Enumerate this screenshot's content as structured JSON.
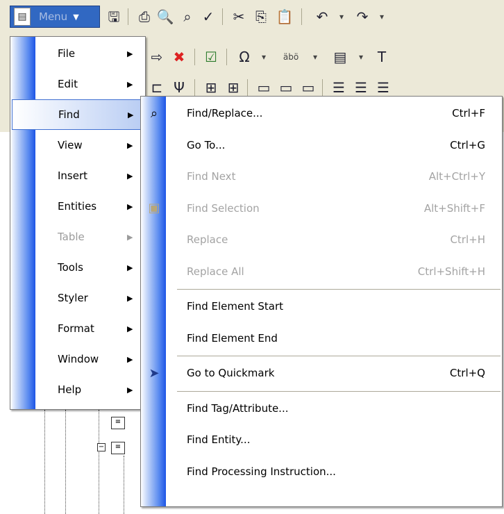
{
  "toolbar": {
    "menu_button_label": "Menu",
    "row1_icons": [
      "save-icon",
      "print-icon",
      "print-preview-icon",
      "find-binoculars-icon",
      "spellcheck-icon",
      "cut-icon",
      "copy-icon",
      "paste-icon",
      "undo-icon",
      "redo-icon"
    ],
    "row2_icons": [
      "insert-element-icon",
      "delete-element-icon",
      "validate-icon",
      "symbol-omega-icon",
      "special-chars-icon",
      "document-icon",
      "text-tag-icon"
    ],
    "row3_icons": [
      "split-icon",
      "join-icon",
      "table-icon",
      "table2-icon",
      "align-left-icon",
      "align-center-icon",
      "align-bottom-icon",
      "justify-icon",
      "justify2-icon",
      "justify3-icon"
    ],
    "special_chars_text": "äbö"
  },
  "main_menu": {
    "items": [
      {
        "label": "File",
        "state": "normal"
      },
      {
        "label": "Edit",
        "state": "normal"
      },
      {
        "label": "Find",
        "state": "selected"
      },
      {
        "label": "View",
        "state": "normal"
      },
      {
        "label": "Insert",
        "state": "normal"
      },
      {
        "label": "Entities",
        "state": "normal"
      },
      {
        "label": "Table",
        "state": "disabled"
      },
      {
        "label": "Tools",
        "state": "normal"
      },
      {
        "label": "Styler",
        "state": "normal"
      },
      {
        "label": "Format",
        "state": "normal"
      },
      {
        "label": "Window",
        "state": "normal"
      },
      {
        "label": "Help",
        "state": "normal"
      }
    ],
    "arrow": "▶"
  },
  "find_submenu": {
    "items": [
      {
        "label": "Find/Replace...",
        "shortcut": "Ctrl+F",
        "icon": "binoculars-icon",
        "enabled": true
      },
      {
        "label": "Go To...",
        "shortcut": "Ctrl+G",
        "icon": "",
        "enabled": true
      },
      {
        "label": "Find Next",
        "shortcut": "Alt+Ctrl+Y",
        "icon": "",
        "enabled": false
      },
      {
        "label": "Find Selection",
        "shortcut": "Alt+Shift+F",
        "icon": "find-selection-icon",
        "enabled": false
      },
      {
        "label": "Replace",
        "shortcut": "Ctrl+H",
        "icon": "",
        "enabled": false
      },
      {
        "label": "Replace All",
        "shortcut": "Ctrl+Shift+H",
        "icon": "",
        "enabled": false
      },
      {
        "label": "Find Element Start",
        "shortcut": "",
        "icon": "",
        "enabled": true
      },
      {
        "label": "Find Element End",
        "shortcut": "",
        "icon": "",
        "enabled": true
      },
      {
        "label": "Go to Quickmark",
        "shortcut": "Ctrl+Q",
        "icon": "quickmark-icon",
        "enabled": true
      },
      {
        "label": "Find Tag/Attribute...",
        "shortcut": "",
        "icon": "",
        "enabled": true
      },
      {
        "label": "Find Entity...",
        "shortcut": "",
        "icon": "",
        "enabled": true
      },
      {
        "label": "Find Processing Instruction...",
        "shortcut": "",
        "icon": "",
        "enabled": true
      }
    ]
  },
  "colors": {
    "menu_highlight": "#3168c2",
    "stripe_dark": "#1d55e6",
    "toolbar_bg": "#ece9d8",
    "disabled_text": "#9b9b9b"
  }
}
